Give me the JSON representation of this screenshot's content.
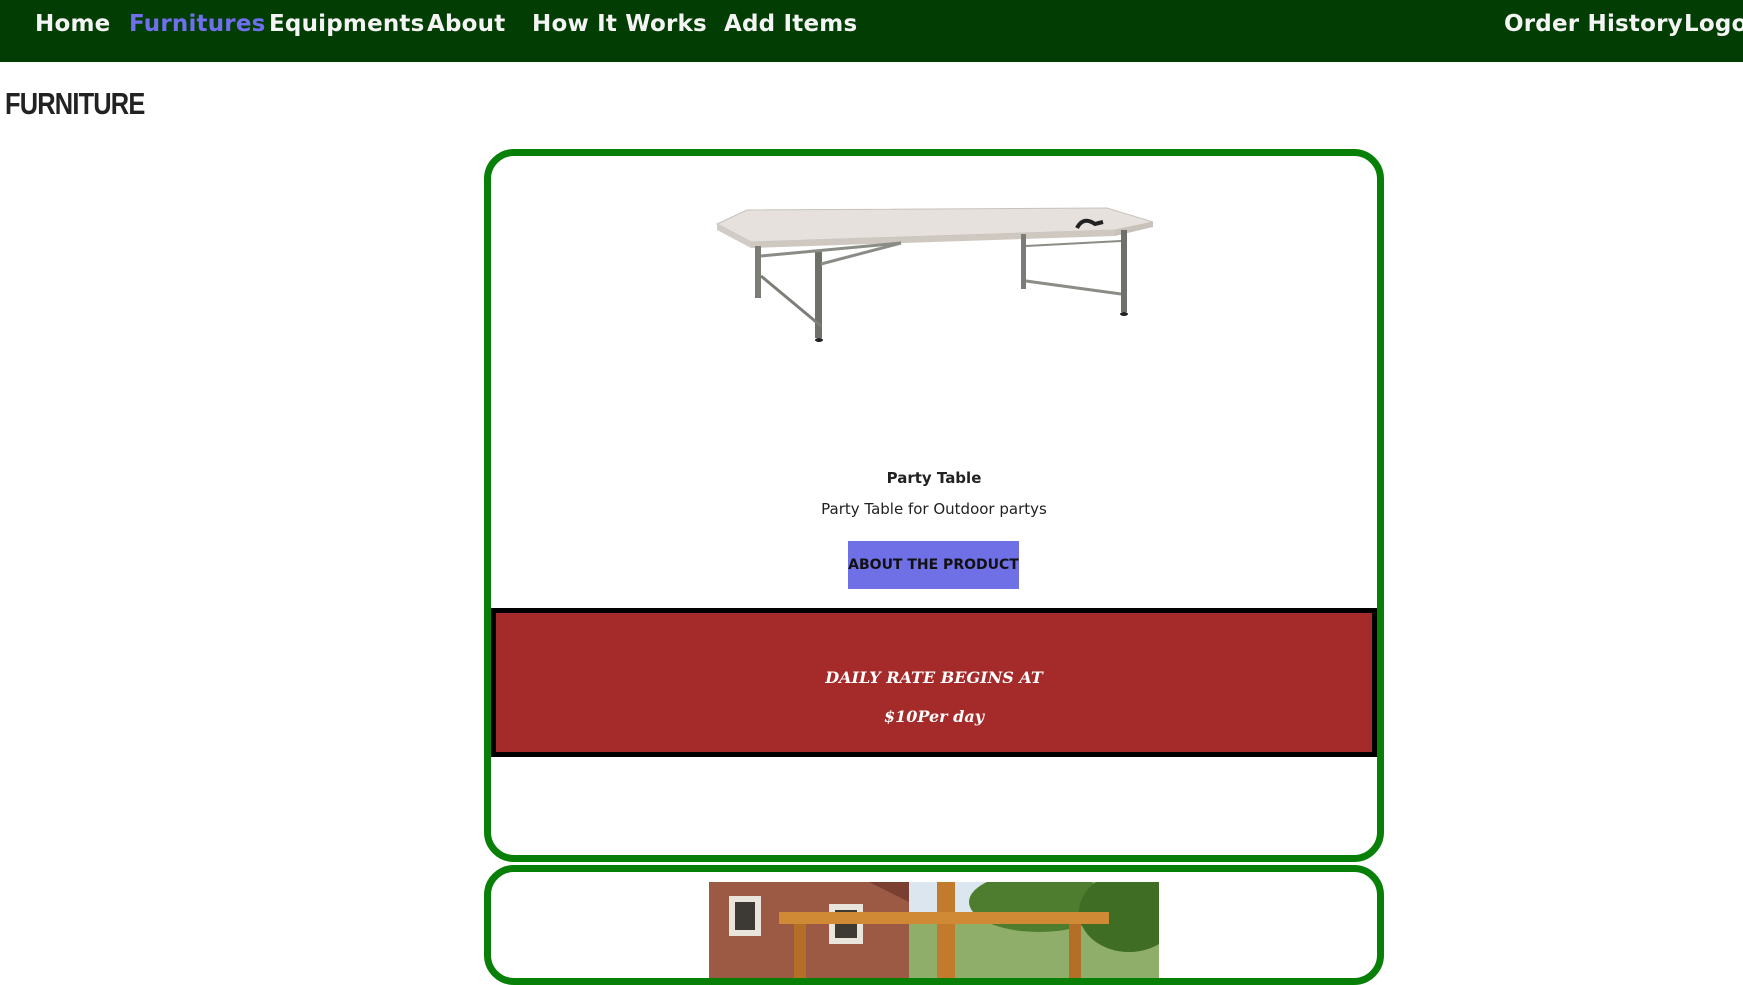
{
  "nav": {
    "links": [
      "Home",
      "Furnitures",
      "Equipments",
      "About",
      "How It Works",
      "Add Items"
    ],
    "right_links": [
      "Order History",
      "Logout"
    ],
    "active": "Furnitures",
    "background": "#023d03",
    "active_color": "#6f6ff0"
  },
  "page": {
    "title": "FURNITURE"
  },
  "products": [
    {
      "name": "Party Table",
      "description": "Party Table for Outdoor partys",
      "button_label": "About the product",
      "rate_heading": "DAILY RATE BEGINS AT",
      "rate_value": "$10Per day",
      "image_icon": "folding-table-photo"
    },
    {
      "image_icon": "garden-furniture-photo"
    }
  ],
  "colors": {
    "card_border": "#088008",
    "button": "#7070e6",
    "rate_box": "#a52a2a"
  }
}
